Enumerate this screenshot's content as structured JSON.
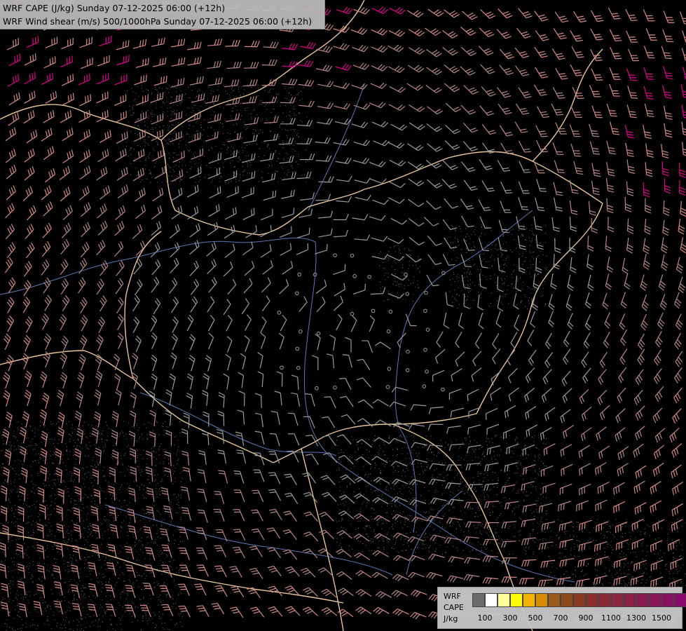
{
  "header": {
    "title_line_1": "WRF CAPE (J/kg) Sunday 07-12-2025 06:00 (+12h)",
    "title_line_2": "WRF Wind shear (m/s) 500/1000hPa Sunday 07-12-2025 06:00 (+12h)"
  },
  "legend": {
    "label_1": "WRF",
    "label_2": "CAPE",
    "label_3": "J/kg",
    "swatch_colors": [
      "#6b6b6b",
      "#ffffff",
      "#ffff99",
      "#ffff00",
      "#f2b200",
      "#d98c00",
      "#9a5a1a",
      "#8a4a1a",
      "#8a3a22",
      "#8a2f2f",
      "#8a2a38",
      "#8a2540",
      "#8a2048",
      "#8a1a52",
      "#8a155a",
      "#8a1062",
      "#8a0a6a"
    ],
    "ticks": [
      "100",
      "300",
      "500",
      "700",
      "900",
      "1100",
      "1300",
      "1500"
    ]
  },
  "colors": {
    "background": "#000000",
    "border": "#e8c49a",
    "river": "#5a78b4",
    "barb_strong": "#e1008c",
    "barb_grey": "#9b9b9b"
  }
}
